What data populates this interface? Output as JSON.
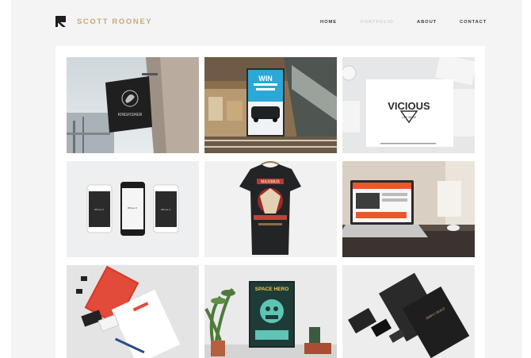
{
  "header": {
    "brand": "SCOTT ROONEY",
    "nav": [
      {
        "label": "HOME",
        "active": false
      },
      {
        "label": "PORTFOLIO",
        "active": true
      },
      {
        "label": "ABOUT",
        "active": false
      },
      {
        "label": "CONTACT",
        "active": false
      }
    ]
  },
  "portfolio": {
    "items": [
      {
        "name": "kingfisher-sign",
        "text": "KINGFISHER"
      },
      {
        "name": "mall-billboard",
        "text": "WIN"
      },
      {
        "name": "vicious-logo",
        "text": "VICIOUS",
        "sub": "LIFE WEAR"
      },
      {
        "name": "iphone-mockups",
        "text": "iPhone X"
      },
      {
        "name": "tshirt-print",
        "text": "MAXIMUS"
      },
      {
        "name": "laptop-website",
        "text": ""
      },
      {
        "name": "stationery-red",
        "text": ""
      },
      {
        "name": "space-hero-poster",
        "text": "SPACE HERO"
      },
      {
        "name": "stationery-dark",
        "text": "SIMPLY BUILD"
      }
    ]
  },
  "colors": {
    "brand": "#c9a97a",
    "nav": "#3a3a3a",
    "nav_active": "#c2c2c2",
    "background": "#f4f4f4"
  }
}
